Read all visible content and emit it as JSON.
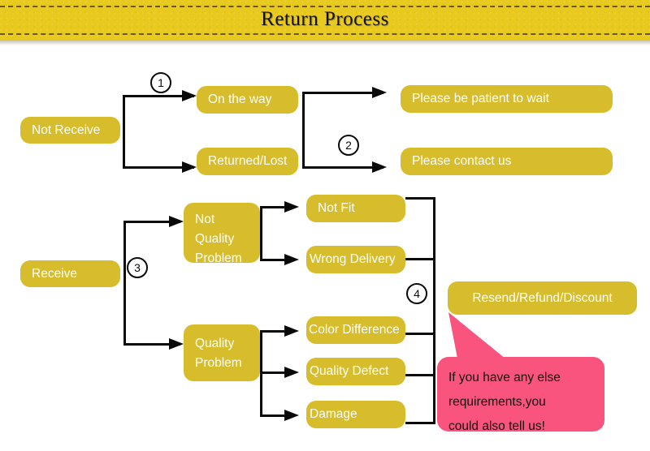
{
  "header": {
    "title": "Return Process",
    "banner_color": "#e8c91e"
  },
  "theme": {
    "node_color": "#d7bd2c",
    "node_text_color": "#fdfdfa",
    "line_color": "#0a0a0a",
    "callout_color": "#f9547d",
    "callout_text_color": "#15110f"
  },
  "diagram": {
    "type": "flowchart",
    "nodes": {
      "not_receive": "Not Receive",
      "on_the_way": "On the way",
      "returned_lost": "Returned/Lost",
      "please_wait": "Please be patient to wait",
      "please_contact": "Please contact us",
      "receive": "Receive",
      "not_quality_problem_line1": "Not",
      "not_quality_problem_line2": "Quality",
      "not_quality_problem_line3": "Problem",
      "quality_problem_line1": "Quality",
      "quality_problem_line2": "Problem",
      "not_fit": "Not Fit",
      "wrong_delivery": "Wrong Delivery",
      "color_difference": "Color Difference",
      "quality_defect": "Quality Defect",
      "damage": "Damage",
      "resolution": "Resend/Refund/Discount"
    },
    "steps": {
      "one": "1",
      "two": "2",
      "three": "3",
      "four": "4"
    },
    "callout": {
      "line1": "If you have any else",
      "line2": "requirements,you",
      "line3": "could also tell us!"
    }
  }
}
